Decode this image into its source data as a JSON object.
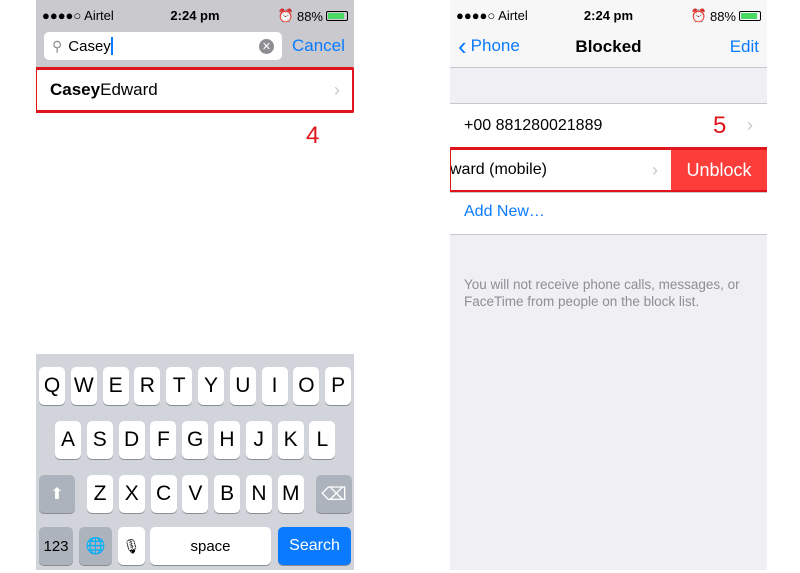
{
  "status": {
    "carrier": "●●●●○ Airtel",
    "time": "2:24 pm",
    "battery": "88%"
  },
  "left": {
    "search_value": "Casey",
    "cancel": "Cancel",
    "result": {
      "bold": "Casey",
      "rest": " Edward"
    },
    "step": "4",
    "keyboard": {
      "rows": [
        [
          "Q",
          "W",
          "E",
          "R",
          "T",
          "Y",
          "U",
          "I",
          "O",
          "P"
        ],
        [
          "A",
          "S",
          "D",
          "F",
          "G",
          "H",
          "J",
          "K",
          "L"
        ],
        [
          "Z",
          "X",
          "C",
          "V",
          "B",
          "N",
          "M"
        ]
      ],
      "numbers": "123",
      "space": "space",
      "search": "Search"
    }
  },
  "right": {
    "back": "Phone",
    "title": "Blocked",
    "edit": "Edit",
    "items": [
      "+00 881280021889",
      "ward (mobile)"
    ],
    "unblock": "Unblock",
    "add_new": "Add New…",
    "step": "5",
    "note": "You will not receive phone calls, messages, or FaceTime from people on the block list."
  },
  "colors": {
    "accent": "#0a7bff",
    "unblock": "#fc3d39",
    "highlight": "#e0141b"
  }
}
